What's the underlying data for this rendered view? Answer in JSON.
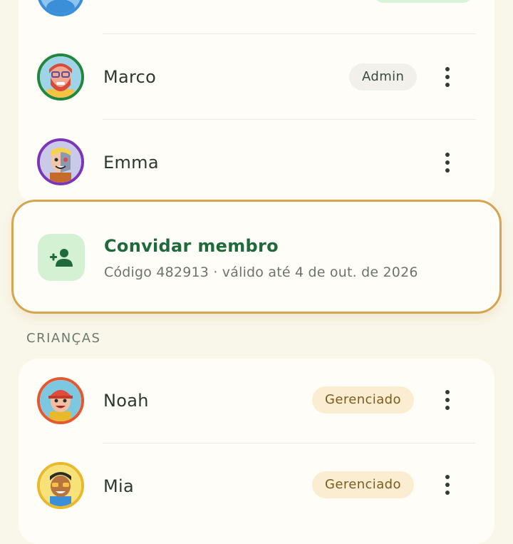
{
  "adults": {
    "members": [
      {
        "name": "",
        "badge": "",
        "avatar_color": "#3a8fd8"
      },
      {
        "name": "Marco",
        "badge": "Admin",
        "avatar_color": "#21873f"
      },
      {
        "name": "Emma",
        "badge": "",
        "avatar_color": "#7b35b8"
      }
    ]
  },
  "invite": {
    "title": "Convidar membro",
    "subtitle": "Código 482913 · válido até 4 de out. de 2026",
    "icon": "person-add-icon"
  },
  "kids": {
    "section_label": "CRIANÇAS",
    "members": [
      {
        "name": "Noah",
        "badge": "Gerenciado",
        "avatar_color": "#e5582f"
      },
      {
        "name": "Mia",
        "badge": "Gerenciado",
        "avatar_color": "#e8b92a"
      }
    ]
  },
  "colors": {
    "background": "#f9f6ea",
    "card": "#fffdf7",
    "accent_green": "#1f6a3c",
    "highlight_border": "#d4a551",
    "managed_badge": "#fbedd2"
  }
}
